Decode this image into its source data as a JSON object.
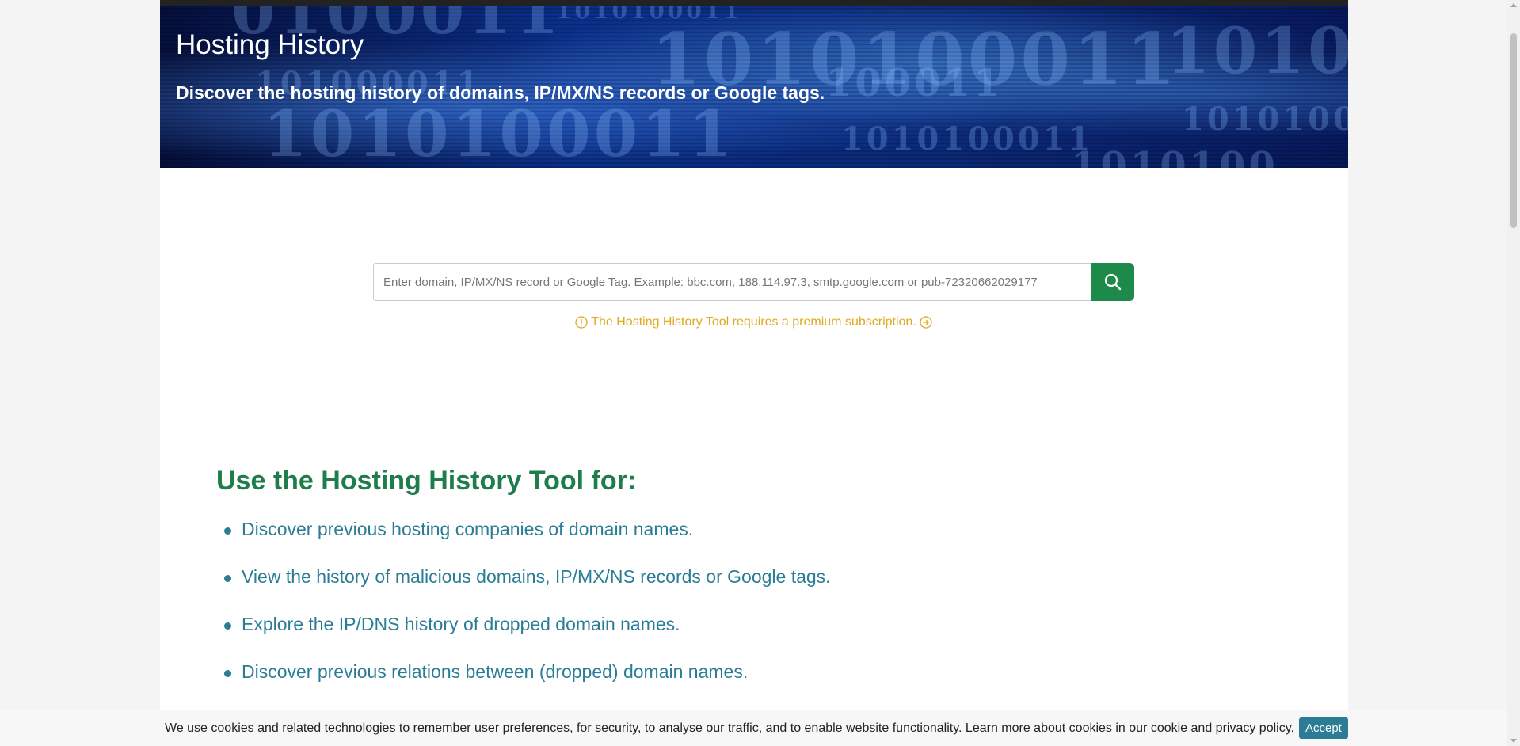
{
  "hero": {
    "title": "Hosting History",
    "subtitle": "Discover the hosting history of domains, IP/MX/NS records or Google tags."
  },
  "search": {
    "placeholder": "Enter domain, IP/MX/NS record or Google Tag. Example: bbc.com, 188.114.97.3, smtp.google.com or pub-72320662029177",
    "button_icon": "search-icon"
  },
  "notice": {
    "text": "The Hosting History Tool requires a premium subscription.",
    "leading_icon": "info-circle-icon",
    "trailing_icon": "arrow-right-circle-icon"
  },
  "uses": {
    "title": "Use the Hosting History Tool for:",
    "items": [
      "Discover previous hosting companies of domain names.",
      "View the history of malicious domains, IP/MX/NS records or Google tags.",
      "Explore the IP/DNS history of dropped domain names.",
      "Discover previous relations between (dropped) domain names."
    ]
  },
  "cookie": {
    "text_before": "We use cookies and related technologies to remember user preferences, for security, to analyse our traffic, and to enable website functionality. Learn more about cookies in our ",
    "link_cookie": "cookie",
    "text_and": " and ",
    "link_privacy": "privacy",
    "text_after": " policy.",
    "accept_label": "Accept"
  },
  "colors": {
    "accent_green": "#1e8a4a",
    "heading_green": "#1e7d4a",
    "link_teal": "#2a7d95",
    "notice_amber": "#e0a820"
  }
}
